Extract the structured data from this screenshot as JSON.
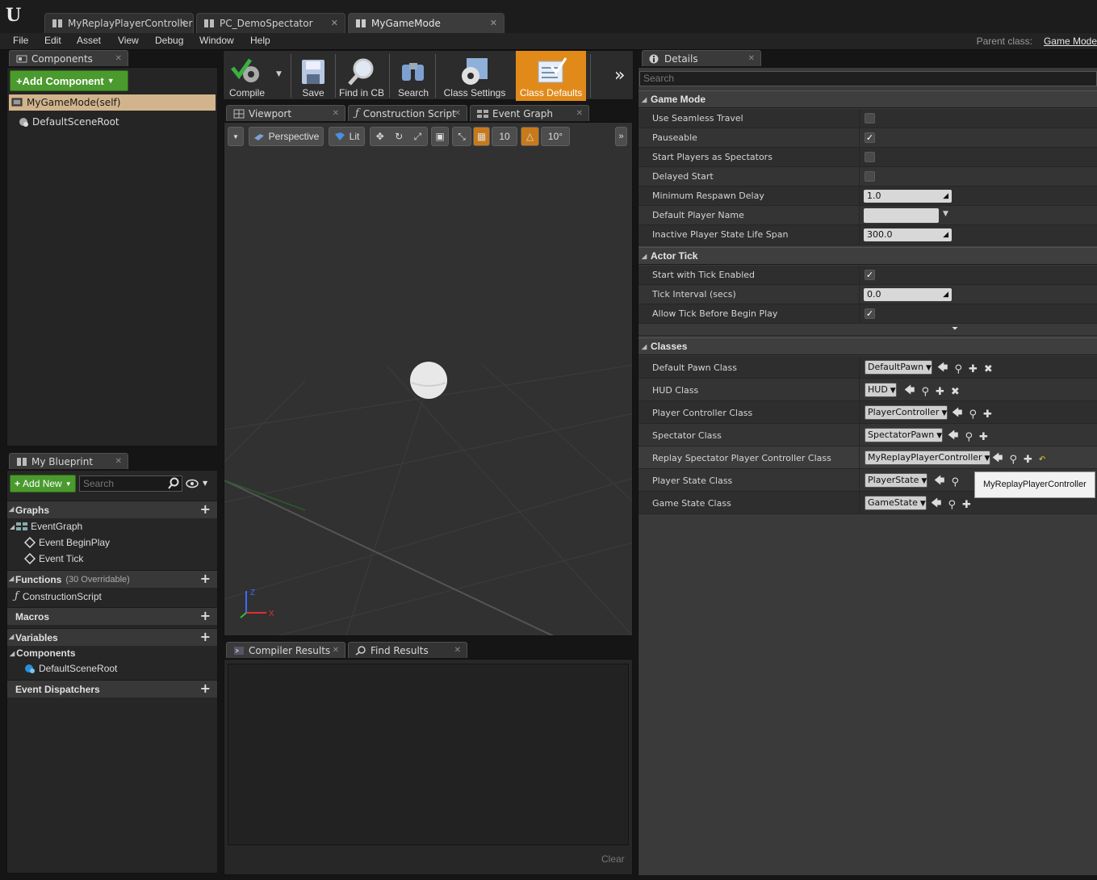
{
  "doc_tabs": [
    {
      "label": "MyReplayPlayerController"
    },
    {
      "label": "PC_DemoSpectator"
    },
    {
      "label": "MyGameMode"
    }
  ],
  "menu": [
    "File",
    "Edit",
    "Asset",
    "View",
    "Debug",
    "Window",
    "Help"
  ],
  "parent_class": {
    "label": "Parent class:",
    "value": "Game Mode"
  },
  "components": {
    "tab": "Components",
    "add_button": "+Add Component",
    "root": "MyGameMode(self)",
    "scene_root": "DefaultSceneRoot"
  },
  "toolbar": {
    "compile": "Compile",
    "save": "Save",
    "find_in_cb": "Find in CB",
    "search": "Search",
    "class_settings": "Class Settings",
    "class_defaults": "Class Defaults"
  },
  "editor_tabs": [
    "Viewport",
    "Construction Script",
    "Event Graph"
  ],
  "viewport": {
    "perspective": "Perspective",
    "lit": "Lit",
    "grid_snap": "10",
    "rot_snap": "10°"
  },
  "my_blueprint": {
    "tab": "My Blueprint",
    "add_new": "Add New",
    "search_placeholder": "Search",
    "graphs": "Graphs",
    "event_graph": "EventGraph",
    "event_begin_play": "Event BeginPlay",
    "event_tick": "Event Tick",
    "functions": "Functions",
    "functions_note": "(30 Overridable)",
    "construction_script": "ConstructionScript",
    "macros": "Macros",
    "variables": "Variables",
    "components": "Components",
    "default_scene_root": "DefaultSceneRoot",
    "event_dispatchers": "Event Dispatchers"
  },
  "bottom_tabs": [
    "Compiler Results",
    "Find Results"
  ],
  "clear": "Clear",
  "details": {
    "tab": "Details",
    "search_placeholder": "Search",
    "game_mode": {
      "title": "Game Mode",
      "use_seamless_travel": {
        "label": "Use Seamless Travel",
        "checked": false
      },
      "pauseable": {
        "label": "Pauseable",
        "checked": true
      },
      "start_players_as_spectators": {
        "label": "Start Players as Spectators",
        "checked": false
      },
      "delayed_start": {
        "label": "Delayed Start",
        "checked": false
      },
      "minimum_respawn_delay": {
        "label": "Minimum Respawn Delay",
        "value": "1.0"
      },
      "default_player_name": {
        "label": "Default Player Name",
        "value": ""
      },
      "inactive_player_state_life_span": {
        "label": "Inactive Player State Life Span",
        "value": "300.0"
      }
    },
    "actor_tick": {
      "title": "Actor Tick",
      "start_with_tick_enabled": {
        "label": "Start with Tick Enabled",
        "checked": true
      },
      "tick_interval": {
        "label": "Tick Interval (secs)",
        "value": "0.0"
      },
      "allow_tick_before_begin_play": {
        "label": "Allow Tick Before Begin Play",
        "checked": true
      }
    },
    "classes": {
      "title": "Classes",
      "default_pawn_class": {
        "label": "Default Pawn Class",
        "value": "DefaultPawn"
      },
      "hud_class": {
        "label": "HUD Class",
        "value": "HUD"
      },
      "player_controller_class": {
        "label": "Player Controller Class",
        "value": "PlayerController"
      },
      "spectator_class": {
        "label": "Spectator Class",
        "value": "SpectatorPawn"
      },
      "replay_spectator_player_controller_class": {
        "label": "Replay Spectator Player Controller Class",
        "value": "MyReplayPlayerController"
      },
      "player_state_class": {
        "label": "Player State Class",
        "value": "PlayerState"
      },
      "game_state_class": {
        "label": "Game State Class",
        "value": "GameState"
      }
    },
    "tooltip": "MyReplayPlayerController"
  },
  "colors": {
    "accent_orange": "#e18a1a",
    "add_green": "#4a9a2e",
    "selected_row": "#d2b48c"
  }
}
